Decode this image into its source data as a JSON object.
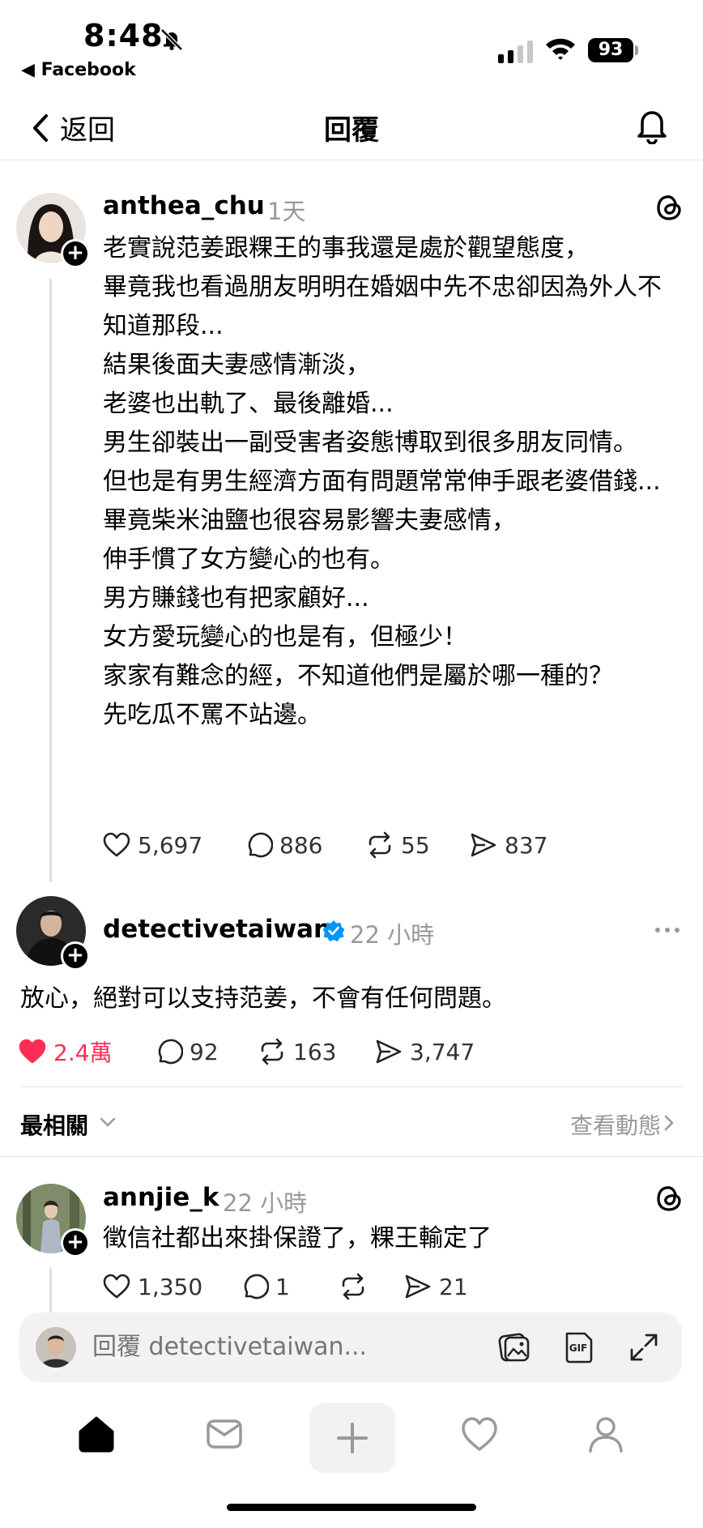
{
  "status_bar": {
    "time": "8:48",
    "back_app": "◀ Facebook",
    "battery": "93"
  },
  "header": {
    "back_label": "返回",
    "title": "回覆"
  },
  "post1": {
    "username": "anthea_chu",
    "time": "1天",
    "text": "老實說范姜跟粿王的事我還是處於觀望態度，\n畢竟我也看過朋友明明在婚姻中先不忠卻因為外人不知道那段...\n結果後面夫妻感情漸淡，\n老婆也出軌了、最後離婚...\n男生卻裝出一副受害者姿態博取到很多朋友同情。\n但也是有男生經濟方面有問題常常伸手跟老婆借錢...\n畢竟柴米油鹽也很容易影響夫妻感情，\n伸手慣了女方變心的也有。\n男方賺錢也有把家顧好...\n女方愛玩變心的也是有，但極少！\n家家有難念的經，不知道他們是屬於哪一種的？\n先吃瓜不罵不站邊。",
    "likes": "5,697",
    "comments": "886",
    "reposts": "55",
    "shares": "837"
  },
  "post2": {
    "username": "detectivetaiwan",
    "time": "22 小時",
    "text": "放心，絕對可以支持范姜，不會有任何問題。",
    "likes": "2.4萬",
    "comments": "92",
    "reposts": "163",
    "shares": "3,747",
    "like_color": "#ff2d55"
  },
  "sort": {
    "label": "最相關",
    "activity": "查看動態"
  },
  "post3": {
    "username": "annjie_k",
    "time": "22 小時",
    "text": "徵信社都出來掛保證了，粿王輸定了",
    "likes": "1,350",
    "comments": "1",
    "reposts": "",
    "shares": "21"
  },
  "reply": {
    "placeholder": "回覆 detectivetaiwan..."
  },
  "tabs": [
    "home-icon",
    "inbox-icon",
    "new-post-icon",
    "activity-icon",
    "profile-icon"
  ]
}
